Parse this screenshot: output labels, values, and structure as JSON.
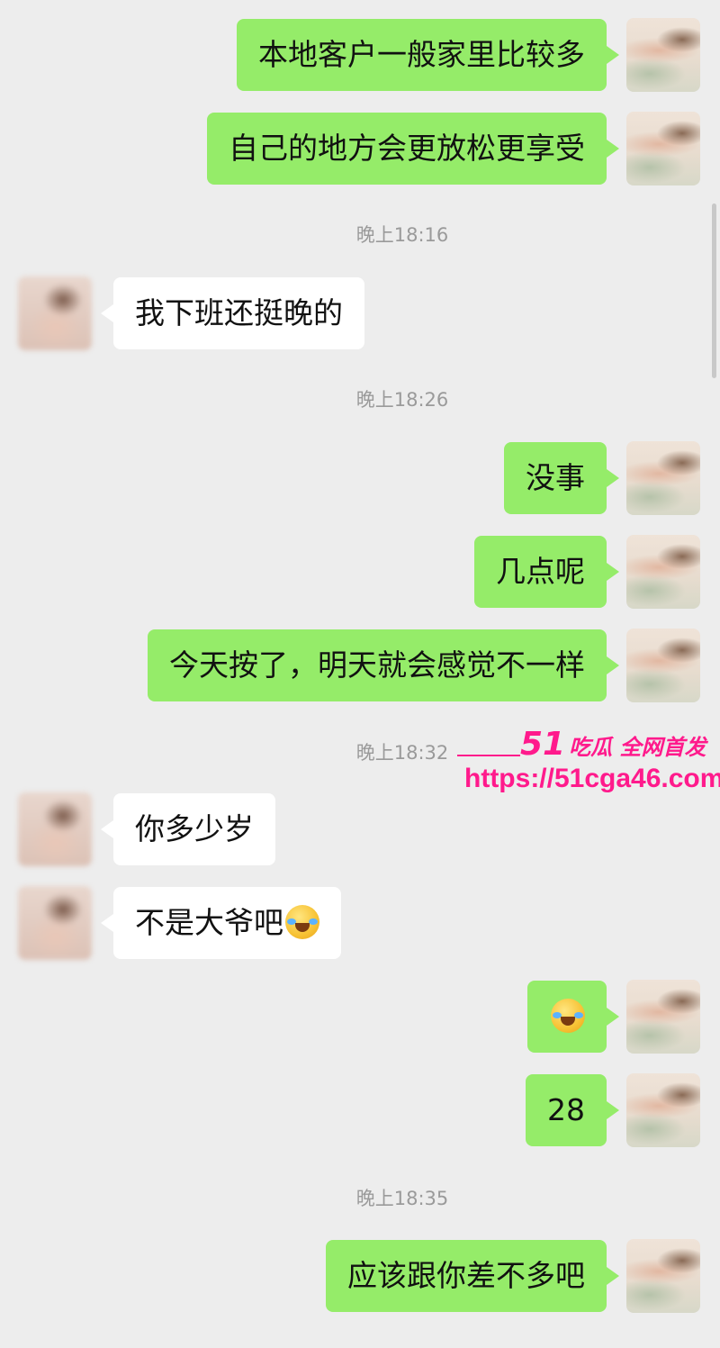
{
  "messages": [
    {
      "side": "me",
      "text": "本地客户一般家里比较多"
    },
    {
      "side": "me",
      "text": "自己的地方会更放松更享受"
    },
    {
      "timestamp": "晚上18:16"
    },
    {
      "side": "peer",
      "text": "我下班还挺晚的"
    },
    {
      "timestamp": "晚上18:26"
    },
    {
      "side": "me",
      "text": "没事"
    },
    {
      "side": "me",
      "text": "几点呢"
    },
    {
      "side": "me",
      "text": "今天按了，明天就会感觉不一样"
    },
    {
      "timestamp": "晚上18:32"
    },
    {
      "side": "peer",
      "text": "你多少岁"
    },
    {
      "side": "peer",
      "text": "不是大爷吧",
      "emoji": "crying-laughing-emoji"
    },
    {
      "side": "me",
      "text": "",
      "emoji": "crying-laughing-emoji"
    },
    {
      "side": "me",
      "text": "28"
    },
    {
      "timestamp": "晚上18:35"
    },
    {
      "side": "me",
      "text": "应该跟你差不多吧"
    }
  ],
  "watermark": {
    "brand_number": "51",
    "brand_text": "吃瓜 全网首发",
    "url": "https://51cga46.com",
    "color": "#ff1a8c"
  },
  "colors": {
    "background": "#ededed",
    "my_bubble": "#95ec69",
    "peer_bubble": "#ffffff",
    "timestamp": "#9a9a9a"
  }
}
